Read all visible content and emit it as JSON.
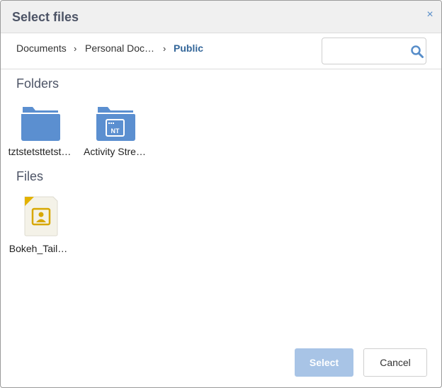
{
  "dialog": {
    "title": "Select files",
    "close_glyph": "×"
  },
  "breadcrumb": {
    "items": [
      "Documents",
      "Personal Doc…",
      "Public"
    ],
    "separator": "›"
  },
  "search": {
    "value": "",
    "placeholder": ""
  },
  "folders": {
    "heading": "Folders",
    "items": [
      {
        "name": "tztstetsttetst…",
        "icon": "folder-icon"
      },
      {
        "name": "Activity Stre…",
        "icon": "activity-stream-folder-icon"
      }
    ]
  },
  "files": {
    "heading": "Files",
    "items": [
      {
        "name": "Bokeh_Tail…",
        "icon": "image-file-icon"
      }
    ]
  },
  "footer": {
    "select_label": "Select",
    "cancel_label": "Cancel"
  },
  "colors": {
    "accent": "#578dc9",
    "folder": "#5b8fd0",
    "select_disabled": "#a8c4e6",
    "active_crumb": "#336699"
  }
}
